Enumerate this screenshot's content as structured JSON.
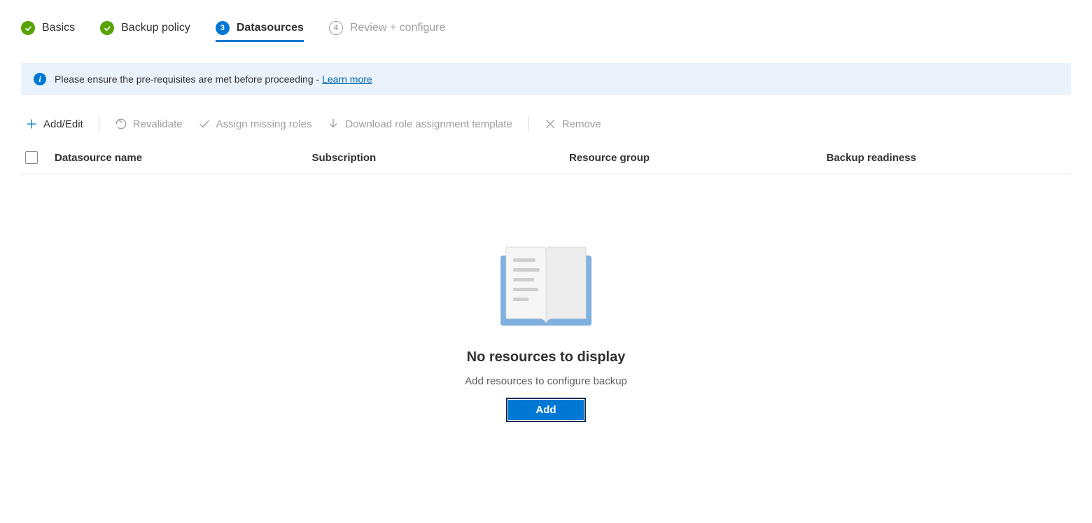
{
  "stepper": {
    "steps": [
      {
        "label": "Basics",
        "state": "completed",
        "number": "1"
      },
      {
        "label": "Backup policy",
        "state": "completed",
        "number": "2"
      },
      {
        "label": "Datasources",
        "state": "current",
        "number": "3"
      },
      {
        "label": "Review + configure",
        "state": "upcoming",
        "number": "4"
      }
    ]
  },
  "info": {
    "text": "Please ensure the pre-requisites are met before proceeding - ",
    "link_label": "Learn more"
  },
  "toolbar": {
    "add_edit": "Add/Edit",
    "revalidate": "Revalidate",
    "assign": "Assign missing roles",
    "download": "Download role assignment template",
    "remove": "Remove"
  },
  "table": {
    "columns": [
      "Datasource name",
      "Subscription",
      "Resource group",
      "Backup readiness"
    ]
  },
  "empty": {
    "title": "No resources to display",
    "subtitle": "Add resources to configure backup",
    "button": "Add"
  }
}
